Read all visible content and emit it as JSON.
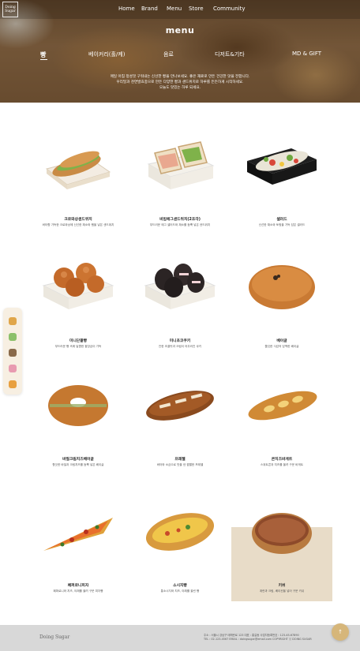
{
  "brand": {
    "logo_line1": "Doing",
    "logo_line2": "Sugar"
  },
  "nav": [
    {
      "label": "Home"
    },
    {
      "label": "Brand"
    },
    {
      "label": "Menu"
    },
    {
      "label": "Store"
    },
    {
      "label": "Community"
    }
  ],
  "hero": {
    "title": "menu",
    "categories": [
      {
        "label": "빵"
      },
      {
        "label": "베이커리(홀/케)"
      },
      {
        "label": "음료"
      },
      {
        "label": "디저트&기타"
      },
      {
        "label": "MD & GIFT"
      }
    ],
    "description_line1": "매일 아침 정성껏 구워내는 신선한 빵을 만나보세요. 좋은 재료로 만든 건강한 맛을 전합니다.",
    "description_line2": "우리밀과 천연발효종으로 만든 다양한 빵과 샌드위치로 하루를 든든하게 시작하세요.",
    "description_line3": "오늘도 맛있는 하루 되세요."
  },
  "products": [
    {
      "name": "크로와상샌드위치",
      "desc": "버터향 가득한 크로와상에 신선한 채소와 햄을 넣은 샌드위치"
    },
    {
      "name": "비빔에그샌드위치(2조각)",
      "desc": "부드러운 에그 샐러드와 채소를 듬뿍 넣은 샌드위치"
    },
    {
      "name": "샐러드",
      "desc": "신선한 채소와 토핑을 가득 담은 샐러드"
    },
    {
      "name": "미니단팥빵",
      "desc": "부드러운 빵 속에 달콤한 팥앙금이 가득"
    },
    {
      "name": "미니초코쿠키",
      "desc": "진한 초콜릿과 크림이 어우러진 쿠키"
    },
    {
      "name": "베이글",
      "desc": "쫄깃한 식감의 담백한 베이글"
    },
    {
      "name": "바질크림치즈베이글",
      "desc": "향긋한 바질과 크림치즈를 듬뿍 넣은 베이글"
    },
    {
      "name": "프레첼",
      "desc": "버터와 소금으로 맛을 낸 짭짤한 프레첼"
    },
    {
      "name": "콘치즈바게트",
      "desc": "스위트콘과 치즈를 올려 구운 바게트"
    },
    {
      "name": "페퍼로니피자",
      "desc": "페퍼로니와 치즈, 야채를 올려 구운 피자빵"
    },
    {
      "name": "소시지빵",
      "desc": "통소시지와 치즈, 야채를 올린 빵"
    },
    {
      "name": "키쉬",
      "desc": "계란과 크림, 베이컨을 넣어 구운 키쉬"
    }
  ],
  "footer": {
    "logo": "Doing Sugar",
    "info_line1": "주소 : 서울시 강남구 테헤란로 123  대표 : 홍길동  사업자등록번호 : 123-45-67890",
    "info_line2": "TEL : 02-123-4567  EMAIL : doingsugar@email.com  COPYRIGHT ⓒ DOING SUGAR"
  },
  "icons": {
    "top_button": "up-arrow-icon"
  },
  "colors": {
    "highlight_card": "#e8dcc8",
    "footer_bg": "#d8d8d8",
    "top_button": "#d6b67a"
  }
}
